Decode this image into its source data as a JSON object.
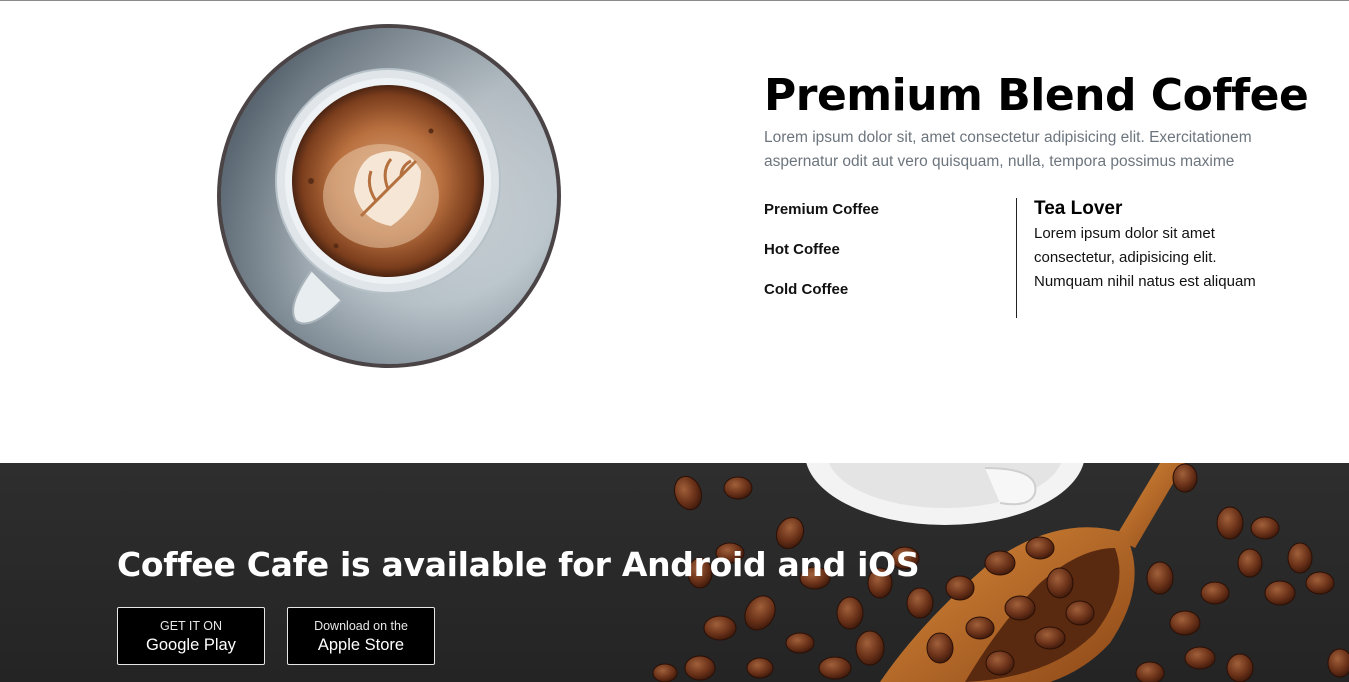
{
  "hero": {
    "title": "Premium Blend Coffee",
    "description": "Lorem ipsum dolor sit, amet consectetur adipisicing elit. Exercitationem aspernatur odit aut vero quisquam, nulla, tempora possimus maxime",
    "menu": [
      "Premium Coffee",
      "Hot Coffee",
      "Cold Coffee"
    ],
    "tea": {
      "title": "Tea Lover",
      "text": "Lorem ipsum dolor sit amet consectetur, adipisicing elit. Numquam nihil natus est aliquam"
    },
    "image": "coffee-cup-latte-art-top-view"
  },
  "banner": {
    "title": "Coffee Cafe is available for Android and iOS",
    "background_image": "coffee-beans-wooden-scoop-dark-table",
    "buttons": [
      {
        "small": "GET IT ON",
        "big": "Google Play"
      },
      {
        "small": "Download on the",
        "big": "Apple Store"
      }
    ]
  },
  "colors": {
    "text_primary": "#000000",
    "text_muted": "#6c757d",
    "banner_bg": "#2a2a2a",
    "button_bg": "#000000"
  }
}
